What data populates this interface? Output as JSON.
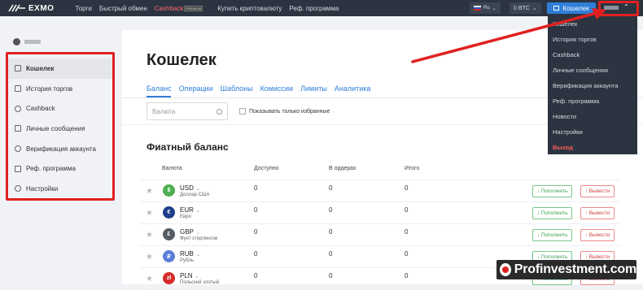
{
  "topbar": {
    "brand": "EXMO",
    "nav": [
      "Торги",
      "Быстрый обмен",
      "Cashback",
      "Купить криптовалюту",
      "Реф. программа"
    ],
    "premium_badge": "PREMIUM",
    "lang": "Ru",
    "btc": "0 BTC",
    "wallet_button": "Кошелек"
  },
  "sidebar": {
    "items": [
      {
        "label": "Кошелек",
        "icon": "wallet-icon"
      },
      {
        "label": "История торгов",
        "icon": "history-icon"
      },
      {
        "label": "Cashback",
        "icon": "cashback-icon"
      },
      {
        "label": "Личные сообщения",
        "icon": "messages-icon"
      },
      {
        "label": "Верификация аккаунта",
        "icon": "verify-icon"
      },
      {
        "label": "Реф. программа",
        "icon": "referral-icon"
      },
      {
        "label": "Настройки",
        "icon": "settings-icon"
      }
    ]
  },
  "main": {
    "title": "Кошелек",
    "tabs": [
      "Баланс",
      "Операции",
      "Шаблоны",
      "Комиссии",
      "Лимиты",
      "Аналитика"
    ],
    "search_placeholder": "Валюта",
    "favorites_label": "Показывать только избранные",
    "section_title": "Фиатный баланс",
    "columns": [
      "Валюта",
      "Доступно",
      "В ордерах",
      "Итого"
    ],
    "rows": [
      {
        "code": "USD",
        "name": "Доллар США",
        "symbol": "$",
        "color": "#4caf50",
        "available": "0",
        "orders": "0",
        "total": "0"
      },
      {
        "code": "EUR",
        "name": "Евро",
        "symbol": "€",
        "color": "#1f3f8a",
        "available": "0",
        "orders": "0",
        "total": "0"
      },
      {
        "code": "GBP",
        "name": "Фунт стерлингов",
        "symbol": "£",
        "color": "#555b63",
        "available": "0",
        "orders": "0",
        "total": "0"
      },
      {
        "code": "RUB",
        "name": "Рубль",
        "symbol": "₽",
        "color": "#5b7fd6",
        "available": "0",
        "orders": "0",
        "total": "0"
      },
      {
        "code": "PLN",
        "name": "Польский злотый",
        "symbol": "zł",
        "color": "#d62b2b",
        "available": "0",
        "orders": "0",
        "total": "0"
      }
    ],
    "deposit_label": "↓ Пополнить",
    "withdraw_label": "↑ Вывести"
  },
  "dropdown": {
    "items": [
      "Кошелек",
      "История торгов",
      "Cashback",
      "Личные сообщения",
      "Верификация аккаунта",
      "Реф. программа",
      "Новости",
      "Настройки",
      "Выход"
    ]
  },
  "watermark": "Profinvestment.com",
  "colors": {
    "accent": "#2f7fd8",
    "annotation": "#e02020",
    "topbar": "#2b3440"
  }
}
